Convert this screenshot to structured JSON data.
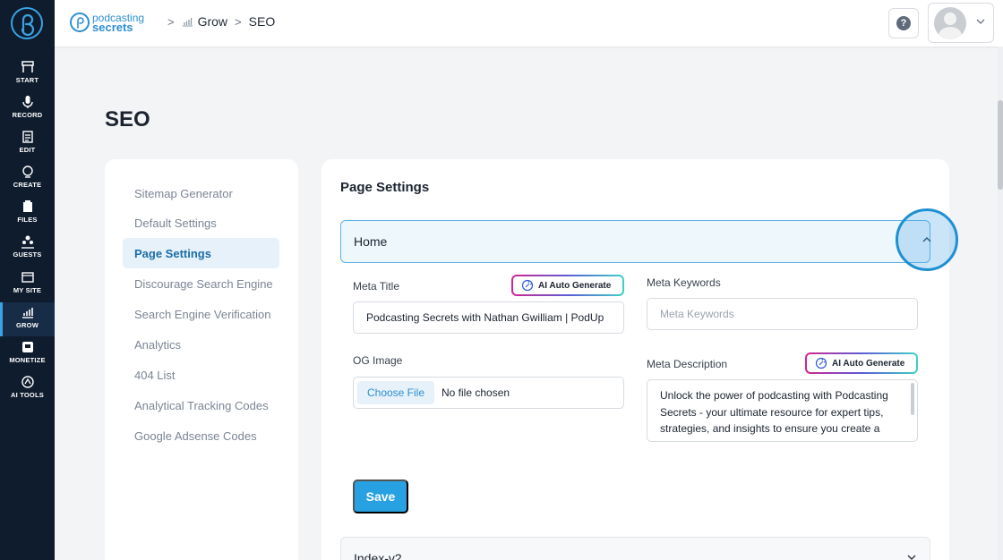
{
  "rail": {
    "items": [
      {
        "label": "START",
        "icon": "start-icon"
      },
      {
        "label": "RECORD",
        "icon": "microphone-icon"
      },
      {
        "label": "EDIT",
        "icon": "edit-icon"
      },
      {
        "label": "CREATE",
        "icon": "create-icon"
      },
      {
        "label": "FILES",
        "icon": "files-icon"
      },
      {
        "label": "GUESTS",
        "icon": "guests-icon"
      },
      {
        "label": "MY SITE",
        "icon": "my-site-icon"
      },
      {
        "label": "GROW",
        "icon": "grow-icon"
      },
      {
        "label": "MONETIZE",
        "icon": "monetize-icon"
      },
      {
        "label": "AI TOOLS",
        "icon": "ai-tools-icon"
      }
    ],
    "active": "GROW"
  },
  "header": {
    "brand_line1": "podcasting",
    "brand_line2": "secrets",
    "breadcrumb": [
      "Grow",
      "SEO"
    ],
    "separator": ">",
    "help_symbol": "?"
  },
  "page": {
    "title": "SEO"
  },
  "menu": {
    "items": [
      "Sitemap Generator",
      "Default Settings",
      "Page Settings",
      "Discourage Search Engine",
      "Search Engine Verification",
      "Analytics",
      "404 List",
      "Analytical Tracking Codes",
      "Google Adsense Codes"
    ],
    "active": "Page Settings"
  },
  "main": {
    "title": "Page Settings",
    "section": "Home",
    "meta_title_label": "Meta Title",
    "meta_title_value": "Podcasting Secrets with Nathan Gwilliam | PodUp",
    "ai_generate_label": "AI Auto Generate",
    "meta_keywords_label": "Meta Keywords",
    "meta_keywords_placeholder": "Meta Keywords",
    "og_image_label": "OG Image",
    "choose_file_label": "Choose File",
    "no_file_label": "No file chosen",
    "meta_description_label": "Meta Description",
    "meta_description_value": "Unlock the power of podcasting with Podcasting Secrets - your ultimate resource for expert tips, strategies, and insights to ensure you create a successful podcast.",
    "save_label": "Save",
    "next_section": "Index-v2"
  },
  "colors": {
    "rail_bg": "#0f1c2e",
    "accent": "#27a1e1",
    "active_menu_bg": "#e6f1fa"
  }
}
